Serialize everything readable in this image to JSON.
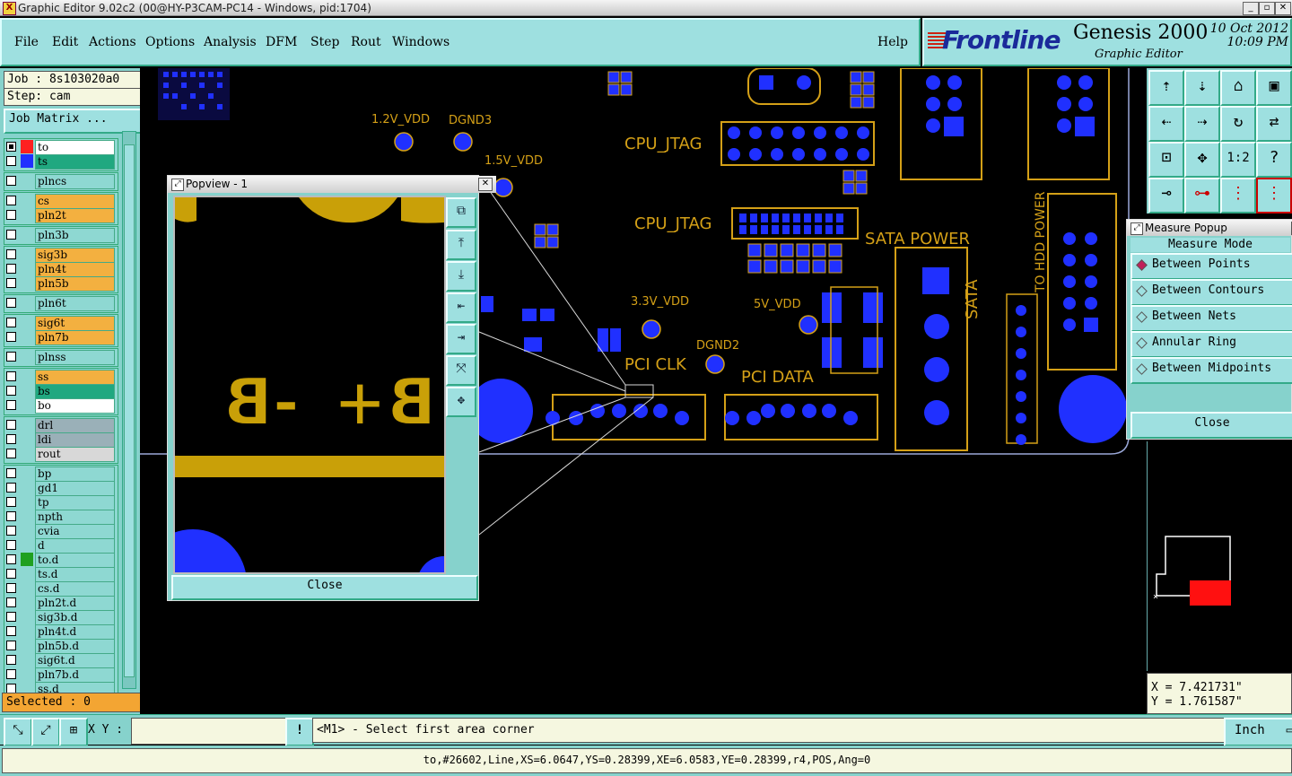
{
  "window": {
    "title": "Graphic Editor 9.02c2 (00@HY-P3CAM-PC14 - Windows, pid:1704)"
  },
  "menu": {
    "items": [
      "File",
      "Edit",
      "Actions",
      "Options",
      "Analysis",
      "DFM",
      "Step",
      "Rout",
      "Windows"
    ],
    "help": "Help"
  },
  "logo": {
    "brand": "Frontline",
    "product": "Genesis 2000",
    "subtitle": "Graphic Editor",
    "date": "10 Oct 2012",
    "time": "10:09 PM"
  },
  "job": {
    "job_label": "Job : 8s103020a0",
    "step_label": "Step: cam",
    "matrix_button": "Job Matrix ...",
    "selected_label": "Selected : 0"
  },
  "layers": [
    {
      "name": "to",
      "color": "#ffffff",
      "swatch": "#ff2020",
      "group": 0
    },
    {
      "name": "ts",
      "color": "#20a880",
      "swatch": "#2030ff",
      "group": 0
    },
    {
      "name": "plncs",
      "color": "#8ed8d2",
      "group": 1
    },
    {
      "name": "cs",
      "color": "#f3b040",
      "group": 2
    },
    {
      "name": "pln2t",
      "color": "#f3b040",
      "group": 2
    },
    {
      "name": "pln3b",
      "color": "#8ed8d2",
      "group": 3
    },
    {
      "name": "sig3b",
      "color": "#f3b040",
      "group": 4
    },
    {
      "name": "pln4t",
      "color": "#f3b040",
      "group": 4
    },
    {
      "name": "pln5b",
      "color": "#f3b040",
      "group": 4
    },
    {
      "name": "pln6t",
      "color": "#8ed8d2",
      "group": 5
    },
    {
      "name": "sig6t",
      "color": "#f3b040",
      "group": 6
    },
    {
      "name": "pln7b",
      "color": "#f3b040",
      "group": 6
    },
    {
      "name": "plnss",
      "color": "#8ed8d2",
      "group": 7
    },
    {
      "name": "ss",
      "color": "#f3b040",
      "group": 8
    },
    {
      "name": "bs",
      "color": "#20a880",
      "group": 8
    },
    {
      "name": "bo",
      "color": "#ffffff",
      "group": 8
    },
    {
      "name": "drl",
      "color": "#9ab0b8",
      "group": 9
    },
    {
      "name": "ldi",
      "color": "#9ab0b8",
      "group": 9
    },
    {
      "name": "rout",
      "color": "#d8d8d8",
      "group": 9
    },
    {
      "name": "bp",
      "color": "#8ed8d2",
      "group": 10
    },
    {
      "name": "gd1",
      "color": "#8ed8d2",
      "group": 10
    },
    {
      "name": "tp",
      "color": "#8ed8d2",
      "group": 10
    },
    {
      "name": "npth",
      "color": "#8ed8d2",
      "group": 10
    },
    {
      "name": "cvia",
      "color": "#8ed8d2",
      "group": 10
    },
    {
      "name": "d",
      "color": "#8ed8d2",
      "group": 10
    },
    {
      "name": "to.d",
      "color": "#8ed8d2",
      "swatch": "#20a020",
      "group": 10
    },
    {
      "name": "ts.d",
      "color": "#8ed8d2",
      "group": 10
    },
    {
      "name": "cs.d",
      "color": "#8ed8d2",
      "group": 10
    },
    {
      "name": "pln2t.d",
      "color": "#8ed8d2",
      "group": 10
    },
    {
      "name": "sig3b.d",
      "color": "#8ed8d2",
      "group": 10
    },
    {
      "name": "pln4t.d",
      "color": "#8ed8d2",
      "group": 10
    },
    {
      "name": "pln5b.d",
      "color": "#8ed8d2",
      "group": 10
    },
    {
      "name": "sig6t.d",
      "color": "#8ed8d2",
      "group": 10
    },
    {
      "name": "pln7b.d",
      "color": "#8ed8d2",
      "group": 10
    },
    {
      "name": "ss.d",
      "color": "#8ed8d2",
      "group": 10
    }
  ],
  "canvas_labels": {
    "v12": "1.2V_VDD",
    "dgnd3": "DGND3",
    "v15": "1.5V_VDD",
    "cpu_jtag1": "CPU_JTAG",
    "cpu_jtag2": "CPU_JTAG",
    "sata_power": "SATA POWER",
    "v33": "3.3V_VDD",
    "v5": "5V_VDD",
    "dgnd2": "DGND2",
    "pci_clk": "PCI CLK",
    "pci_data": "PCI DATA",
    "sata": "SATA",
    "to_hdd_power": "TO HDD POWER"
  },
  "popview": {
    "title": "Popview - 1",
    "text_minus": "-B",
    "text_plus": "B+",
    "close": "Close"
  },
  "measure": {
    "title": "Measure Popup",
    "header": "Measure Mode",
    "options": [
      "Between Points",
      "Between Contours",
      "Between Nets",
      "Annular Ring",
      "Between Midpoints"
    ],
    "selected_index": 0,
    "close": "Close"
  },
  "coords": {
    "x": "X = 7.421731\"",
    "y": "Y = 1.761587\""
  },
  "bottom": {
    "xy_label": "X Y :",
    "xy_value": "",
    "prompt": "<M1> - Select first area corner",
    "unit": "Inch"
  },
  "status": {
    "text": "to,#26602,Line,XS=6.0647,YS=0.28399,XE=6.0583,YE=0.28399,r4,POS,Ang=0"
  }
}
